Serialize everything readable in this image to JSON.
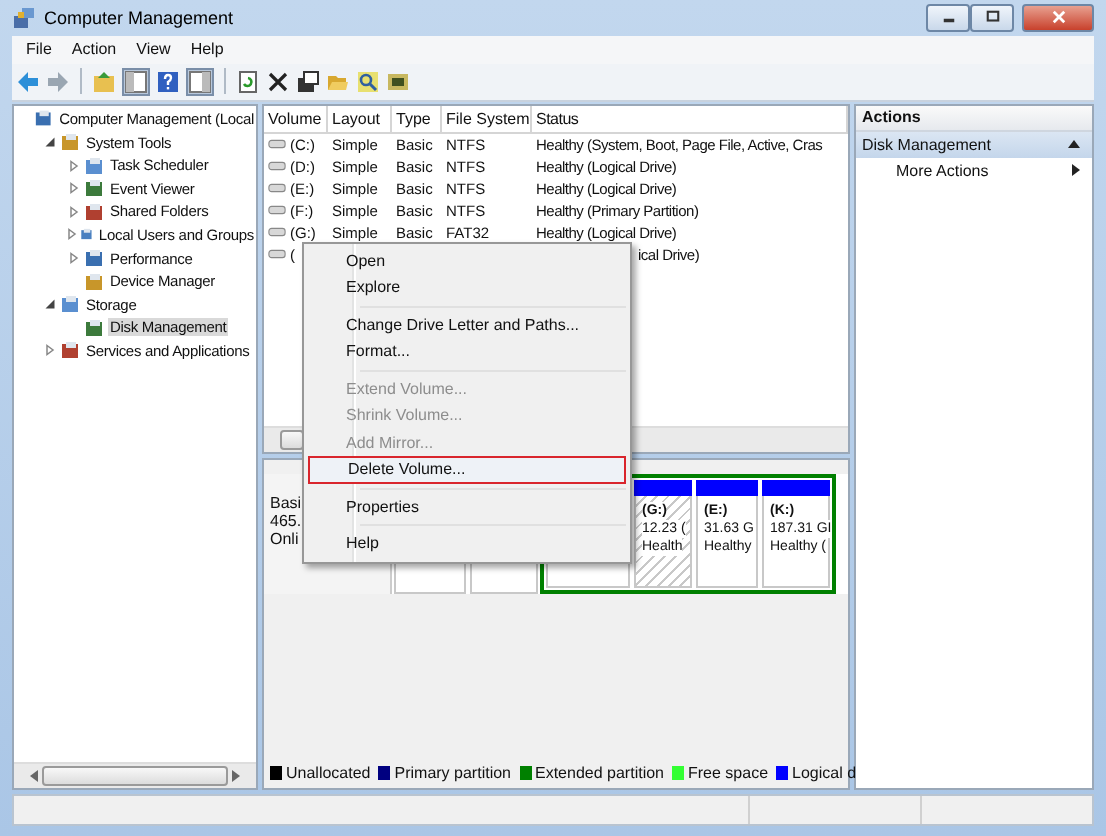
{
  "window": {
    "title": "Computer Management"
  },
  "menu": [
    "File",
    "Action",
    "View",
    "Help"
  ],
  "tree": [
    {
      "label": "Computer Management (Local",
      "selected": false,
      "children": [
        {
          "label": "System Tools",
          "expanded": true,
          "selected": false,
          "children": [
            {
              "label": "Task Scheduler",
              "expanded": false,
              "selected": false
            },
            {
              "label": "Event Viewer",
              "expanded": false,
              "selected": false
            },
            {
              "label": "Shared Folders",
              "expanded": false,
              "selected": false
            },
            {
              "label": "Local Users and Groups",
              "expanded": false,
              "selected": false
            },
            {
              "label": "Performance",
              "expanded": false,
              "selected": false
            },
            {
              "label": "Device Manager",
              "selected": false
            }
          ]
        },
        {
          "label": "Storage",
          "expanded": true,
          "selected": false,
          "children": [
            {
              "label": "Disk Management",
              "selected": true
            }
          ]
        },
        {
          "label": "Services and Applications",
          "expanded": false,
          "selected": false
        }
      ]
    }
  ],
  "table": {
    "columns": [
      "Volume",
      "Layout",
      "Type",
      "File System",
      "Status"
    ],
    "rows": [
      {
        "cells": [
          "(C:)",
          "Simple",
          "Basic",
          "NTFS",
          "Healthy (System, Boot, Page File, Active, Cras"
        ],
        "covered": false
      },
      {
        "cells": [
          "(D:)",
          "Simple",
          "Basic",
          "NTFS",
          "Healthy (Logical Drive)"
        ],
        "covered": false
      },
      {
        "cells": [
          "(E:)",
          "Simple",
          "Basic",
          "NTFS",
          "Healthy (Logical Drive)"
        ],
        "covered": false
      },
      {
        "cells": [
          "(F:)",
          "Simple",
          "Basic",
          "NTFS",
          "Healthy (Primary Partition)"
        ],
        "covered": false
      },
      {
        "cells": [
          "(G:)",
          "Simple",
          "Basic",
          "FAT32",
          "Healthy (Logical Drive)"
        ],
        "covered": false
      },
      {
        "cells": [
          "(",
          "",
          "",
          "",
          "ical Drive)"
        ],
        "covered": true
      }
    ]
  },
  "disk": {
    "label": [
      "Basi",
      "465.",
      "Onli"
    ],
    "partitions": [
      {
        "kind": "primary"
      },
      {
        "kind": "primary"
      },
      {
        "kind": "extended",
        "logical": [
          {
            "selected": false
          },
          {
            "name": "(G:)",
            "size": "12.23 (",
            "status": "Health",
            "selected": true
          },
          {
            "name": "(E:)",
            "size": "31.63 G",
            "status": "Healthy",
            "selected": false
          },
          {
            "name": "(K:)",
            "size": "187.31 GI",
            "status": "Healthy (",
            "selected": false
          }
        ]
      }
    ]
  },
  "legend": [
    {
      "label": "Unallocated",
      "color": "#000000"
    },
    {
      "label": "Primary partition",
      "color": "#000080"
    },
    {
      "label": "Extended partition",
      "color": "#008000"
    },
    {
      "label": "Free space",
      "color": "#33ff33"
    },
    {
      "label": "Logical d",
      "color": "#0000ff"
    }
  ],
  "context_menu": [
    {
      "kind": "item",
      "label": "Open",
      "disabled": false,
      "selected": false
    },
    {
      "kind": "item",
      "label": "Explore",
      "disabled": false,
      "selected": false
    },
    {
      "kind": "separator"
    },
    {
      "kind": "item",
      "label": "Change Drive Letter and Paths...",
      "disabled": false,
      "selected": false
    },
    {
      "kind": "item",
      "label": "Format...",
      "disabled": false,
      "selected": false
    },
    {
      "kind": "separator"
    },
    {
      "kind": "item",
      "label": "Extend Volume...",
      "disabled": true,
      "selected": false
    },
    {
      "kind": "item",
      "label": "Shrink Volume...",
      "disabled": true,
      "selected": false
    },
    {
      "kind": "item",
      "label": "Add Mirror...",
      "disabled": true,
      "selected": false
    },
    {
      "kind": "item",
      "label": "Delete Volume...",
      "disabled": false,
      "selected": true
    },
    {
      "kind": "separator"
    },
    {
      "kind": "item",
      "label": "Properties",
      "disabled": false,
      "selected": false
    },
    {
      "kind": "separator"
    },
    {
      "kind": "item",
      "label": "Help",
      "disabled": false,
      "selected": false
    }
  ],
  "actions": {
    "title": "Actions",
    "items": [
      {
        "kind": "section",
        "label": "Disk Management"
      },
      {
        "kind": "action",
        "label": "More Actions"
      }
    ]
  }
}
